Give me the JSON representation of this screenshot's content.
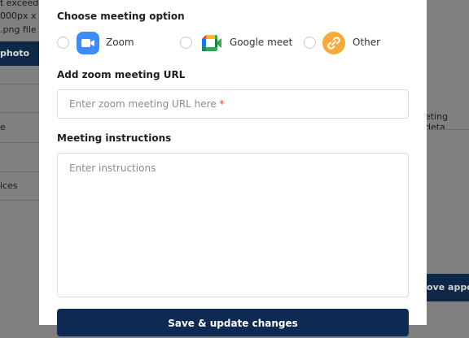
{
  "background": {
    "fragments": [
      "t exceed",
      "000px x 1",
      ".png file fo"
    ],
    "photo_tab": "photo",
    "row_e": "e",
    "row_services": "ices",
    "meeting_details": "eting deta",
    "approve_button": "ove appoi"
  },
  "modal": {
    "choose_title": "Choose meeting option",
    "options": [
      {
        "label": "Zoom",
        "icon": "zoom-icon"
      },
      {
        "label": "Google meet",
        "icon": "google-meet-icon"
      },
      {
        "label": "Other",
        "icon": "link-icon"
      }
    ],
    "url_title": "Add zoom meeting URL",
    "url_placeholder": "Enter zoom meeting URL here",
    "required_mark": "*",
    "instructions_title": "Meeting instructions",
    "instructions_placeholder": "Enter instructions",
    "save_label": "Save & update changes"
  },
  "colors": {
    "primary": "#0f2a52",
    "zoom": "#3d8cff",
    "other": "#f7a93a",
    "required": "#e0413a"
  }
}
